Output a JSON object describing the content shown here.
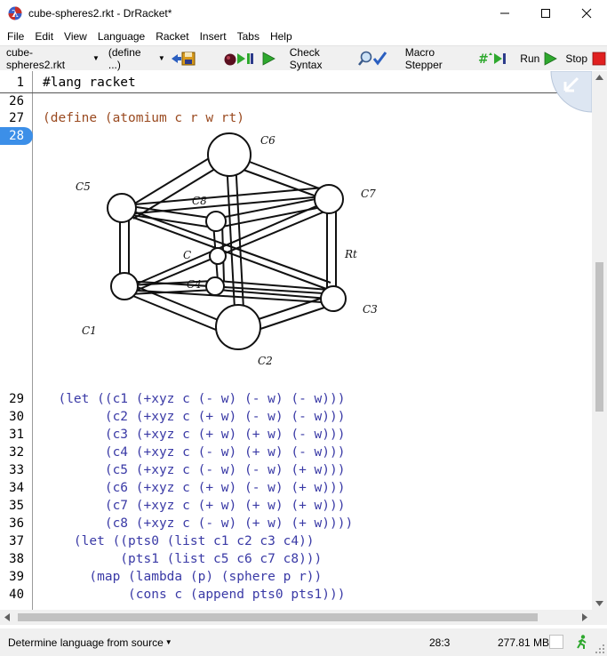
{
  "window": {
    "title": "cube-spheres2.rkt - DrRacket*",
    "minimize_glyph": "—",
    "maximize_glyph": "☐",
    "close_glyph": "✕"
  },
  "menu": {
    "items": [
      "File",
      "Edit",
      "View",
      "Language",
      "Racket",
      "Insert",
      "Tabs",
      "Help"
    ]
  },
  "toolbar": {
    "file_menu": "cube-spheres2.rkt",
    "define_menu": "(define ...)",
    "check_syntax": "Check Syntax",
    "macro_stepper": "Macro Stepper",
    "run": "Run",
    "stop": "Stop"
  },
  "editor": {
    "lang_line_number": "1",
    "lang_line": "#lang racket",
    "line_26": "26",
    "line_27": "27",
    "line_28": "28",
    "code_27": "(define (atomium c r w rt)",
    "image_labels": {
      "c1": "C1",
      "c2": "C2",
      "c3": "C3",
      "c4": "C4",
      "c5": "C5",
      "c6": "C6",
      "c7": "C7",
      "c8": "C8",
      "c": "C",
      "rt": "Rt"
    },
    "lines": [
      {
        "num": "29",
        "text": "  (let ((c1 (+xyz c (- w) (- w) (- w)))"
      },
      {
        "num": "30",
        "text": "        (c2 (+xyz c (+ w) (- w) (- w)))"
      },
      {
        "num": "31",
        "text": "        (c3 (+xyz c (+ w) (+ w) (- w)))"
      },
      {
        "num": "32",
        "text": "        (c4 (+xyz c (- w) (+ w) (- w)))"
      },
      {
        "num": "33",
        "text": "        (c5 (+xyz c (- w) (- w) (+ w)))"
      },
      {
        "num": "34",
        "text": "        (c6 (+xyz c (+ w) (- w) (+ w)))"
      },
      {
        "num": "35",
        "text": "        (c7 (+xyz c (+ w) (+ w) (+ w)))"
      },
      {
        "num": "36",
        "text": "        (c8 (+xyz c (- w) (+ w) (+ w))))"
      },
      {
        "num": "37",
        "text": "    (let ((pts0 (list c1 c2 c3 c4))"
      },
      {
        "num": "38",
        "text": "          (pts1 (list c5 c6 c7 c8)))"
      },
      {
        "num": "39",
        "text": "      (map (lambda (p) (sphere p r))"
      },
      {
        "num": "40",
        "text": "           (cons c (append pts0 pts1)))"
      }
    ]
  },
  "status": {
    "language": "Determine language from source",
    "position": "28:3",
    "memory": "277.81 MB"
  },
  "colors": {
    "keyword": "#3a3aa6",
    "paren": "#9a4a20",
    "active_line": "#3c8fe8"
  }
}
